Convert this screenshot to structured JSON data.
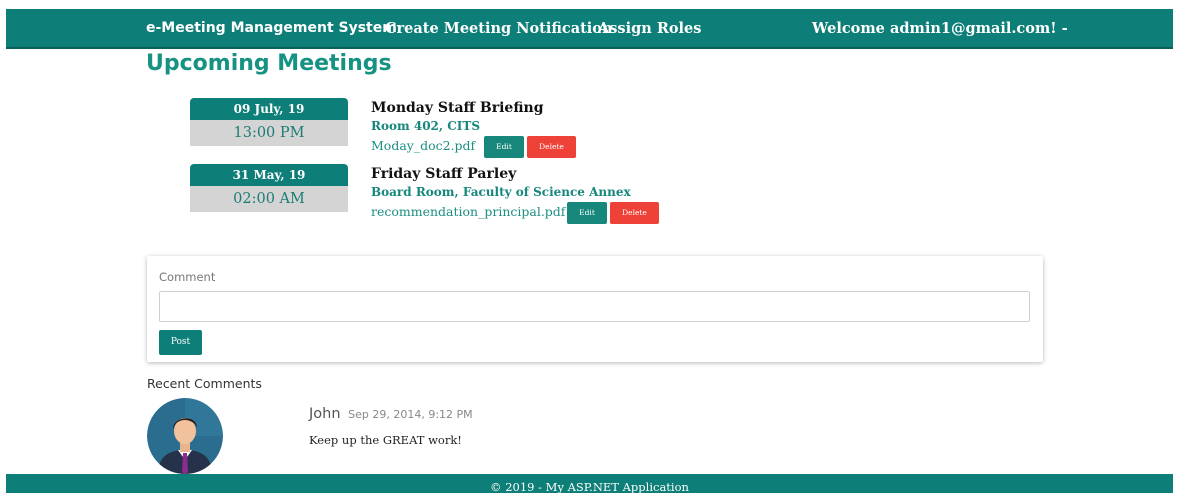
{
  "navbar": {
    "brand": "e-Meeting Management System",
    "create_link": "Create Meeting Notification",
    "roles_link": "Assign Roles",
    "welcome": "Welcome admin1@gmail.com! -"
  },
  "page_title": "Upcoming Meetings",
  "meetings": [
    {
      "date": "09 July, 19",
      "time": "13:00 PM",
      "title": "Monday Staff Briefing",
      "room": "Room 402, CITS",
      "file": "Moday_doc2.pdf",
      "edit_label": "Edit",
      "delete_label": "Delete"
    },
    {
      "date": "31 May, 19",
      "time": "02:00 AM",
      "title": "Friday Staff Parley",
      "room": "Board Room, Faculty of Science Annex",
      "file": "recommendation_principal.pdf",
      "edit_label": "Edit",
      "delete_label": "Delete"
    }
  ],
  "comment_form": {
    "label": "Comment",
    "value": "",
    "post_label": "Post"
  },
  "recent": {
    "title": "Recent Comments",
    "comments": [
      {
        "name": "John",
        "date": "Sep 29, 2014, 9:12 PM",
        "text": "Keep up the GREAT work!",
        "avatar_icon": "user-avatar-icon"
      }
    ]
  },
  "footer": "© 2019 - My ASP.NET Application",
  "colors": {
    "primary": "#0d7f78",
    "accent_text": "#169283",
    "danger": "#ee4138",
    "time_bg": "#d4d4d4"
  }
}
